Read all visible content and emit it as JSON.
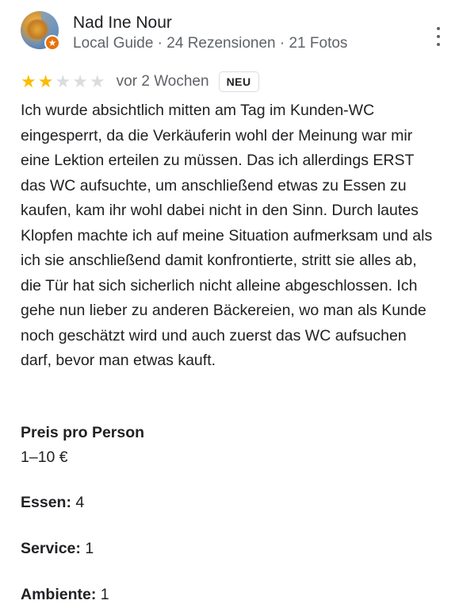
{
  "reviewer": {
    "name": "Nad Ine Nour",
    "meta": "Local Guide · 24 Rezensionen · 21 Fotos",
    "avatar_icon": "user-avatar-photo",
    "badge_icon": "local-guide-star-icon"
  },
  "rating": {
    "stars": 2,
    "max": 5,
    "time": "vor 2 Wochen",
    "badge": "NEU"
  },
  "review_text": "Ich wurde absichtlich mitten am Tag im Kunden-WC eingesperrt, da die Verkäuferin wohl der Meinung war mir eine Lektion erteilen zu müssen. Das ich allerdings ERST das WC aufsuchte, um anschließend etwas zu Essen zu kaufen, kam ihr wohl dabei nicht in den Sinn. Durch lautes Klopfen machte ich auf meine Situation aufmerksam und als ich sie anschließend damit konfrontierte, stritt sie alles ab, die Tür hat sich sicherlich nicht alleine abgeschlossen. Ich gehe nun lieber zu anderen Bäckereien, wo man als Kunde noch geschätzt wird und auch zuerst das WC aufsuchen darf, bevor man etwas kauft.",
  "details": {
    "price_label": "Preis pro Person",
    "price_value": "1–10 €",
    "food_label": "Essen:",
    "food_value": "4",
    "service_label": "Service:",
    "service_value": "1",
    "ambience_label": "Ambiente:",
    "ambience_value": "1"
  },
  "colors": {
    "star_filled": "#fbbc04",
    "star_empty": "#dadce0",
    "guide_badge": "#e8710a",
    "secondary_text": "#5f6368"
  }
}
